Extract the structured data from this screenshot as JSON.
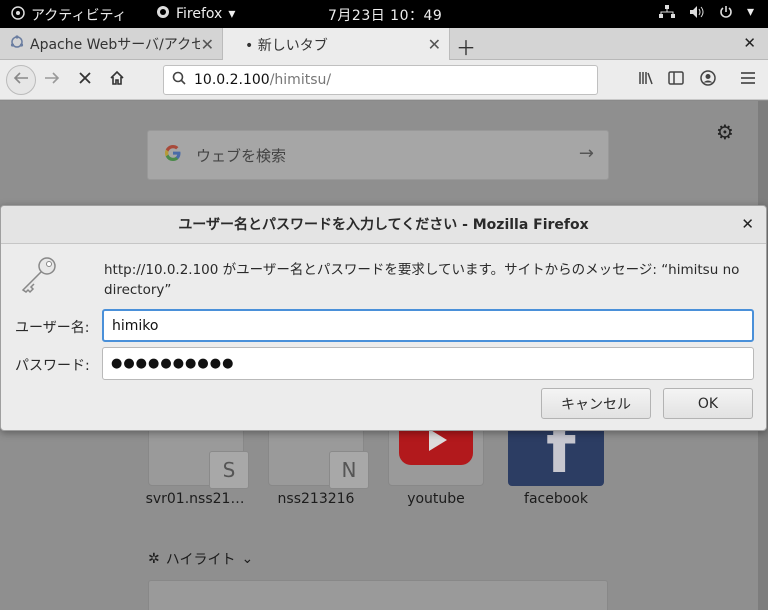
{
  "topbar": {
    "activities": "アクティビティ",
    "app_name": "Firefox",
    "clock": "7月23日  10：49"
  },
  "tabs": [
    {
      "label": "Apache Webサーバ/アクセ",
      "active": false
    },
    {
      "label": "• 新しいタブ",
      "active": true
    }
  ],
  "navbar": {
    "url_host": "10.0.2.100",
    "url_path": "/himitsu/"
  },
  "newtab_page": {
    "search_placeholder": "ウェブを検索",
    "top_sites": [
      {
        "label": "svr01.nss21…",
        "letter": "S"
      },
      {
        "label": "nss213216",
        "letter": "N"
      },
      {
        "label": "youtube"
      },
      {
        "label": "facebook"
      }
    ],
    "highlights_label": "ハイライト"
  },
  "dialog": {
    "title": "ユーザー名とパスワードを入力してください - Mozilla Firefox",
    "message": "http://10.0.2.100 がユーザー名とパスワードを要求しています。サイトからのメッセージ: “himitsu no directory”",
    "username_label": "ユーザー名:",
    "username_value": "himiko",
    "password_label": "パスワード:",
    "password_mask": "●●●●●●●●●●",
    "cancel_label": "キャンセル",
    "ok_label": "OK"
  },
  "colors": {
    "focus_ring": "#4a90d9",
    "youtube_red": "#b2191c",
    "facebook_blue": "#2c3d63"
  }
}
